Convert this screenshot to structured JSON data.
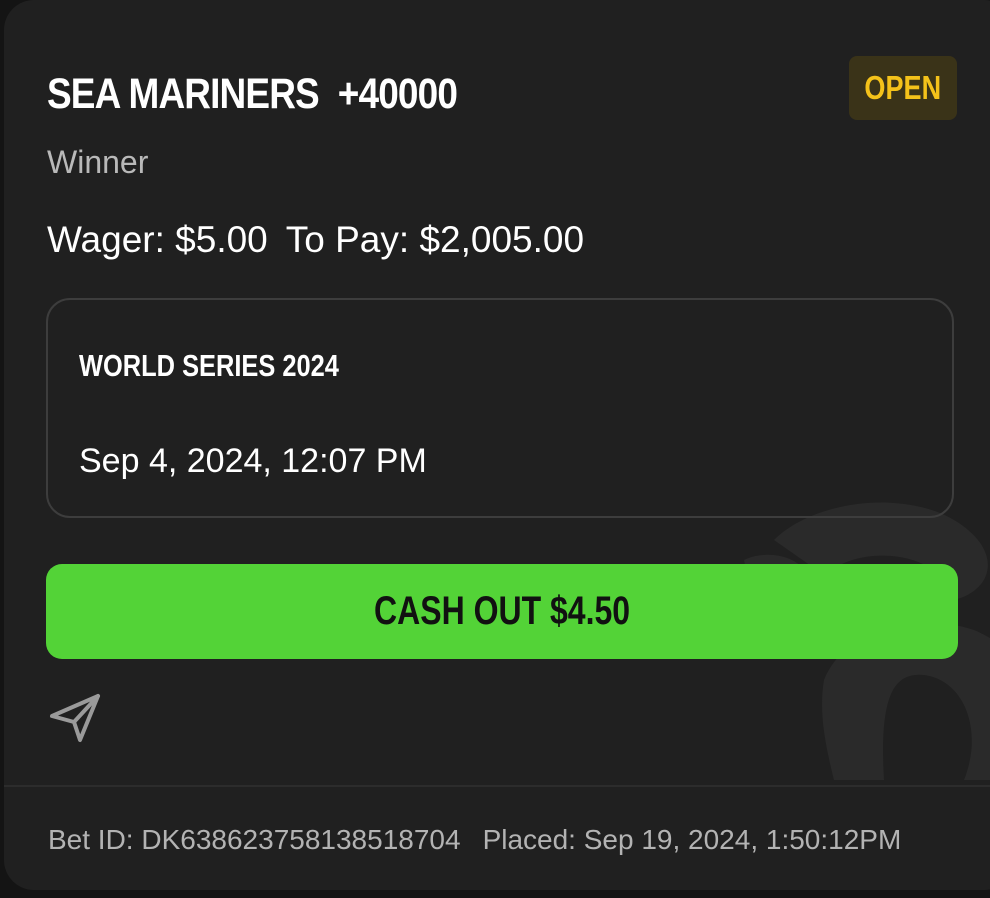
{
  "bet": {
    "selection": "SEA MARINERS",
    "odds": "+40000",
    "status": "OPEN",
    "market": "Winner",
    "wager_label": "Wager: $5.00",
    "to_pay_label": "To Pay: $2,005.00"
  },
  "event": {
    "name": "WORLD SERIES 2024",
    "datetime": "Sep 4, 2024, 12:07 PM"
  },
  "actions": {
    "cashout_label": "CASH OUT $4.50",
    "share_icon": "send-icon"
  },
  "footer": {
    "bet_id": "Bet ID: DK638623758138518704",
    "placed": "Placed: Sep 19, 2024, 1:50:12PM"
  },
  "colors": {
    "card_background": "#202020",
    "accent_green": "#53d337",
    "status_yellow": "#f4c21a",
    "status_badge_bg": "#3a3318"
  }
}
